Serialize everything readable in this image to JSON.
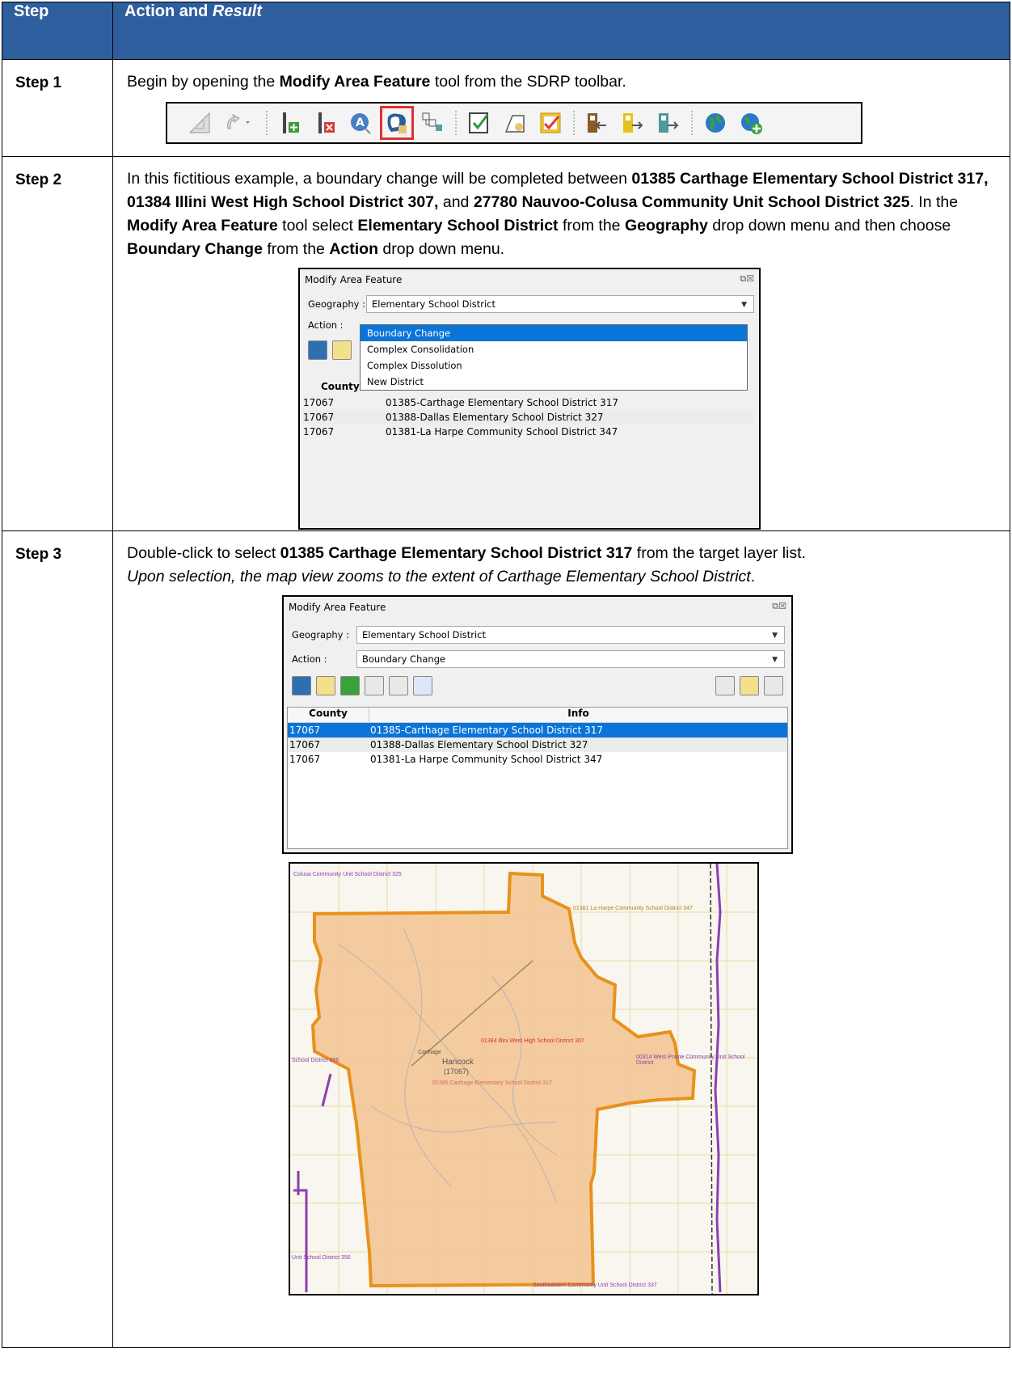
{
  "header": {
    "col1": "Step",
    "col2_prefix": "Action and ",
    "col2_italic": "Result"
  },
  "step1": {
    "label": "Step 1",
    "text_a": "Begin by opening the ",
    "bold_a": "Modify Area Feature",
    "text_b": " tool from the SDRP toolbar.",
    "toolbar_icons": [
      "ruler-icon",
      "pointer-dropdown-icon",
      "add-line-icon",
      "remove-line-icon",
      "label-tool-icon",
      "modify-area-feature-icon",
      "split-tool-icon",
      "validate-icon",
      "edit-polygon-icon",
      "save-polygon-icon",
      "import-icon",
      "export-icon",
      "transfer-icon",
      "globe-icon",
      "add-globe-icon"
    ]
  },
  "step2": {
    "label": "Step 2",
    "t1": "In this fictitious example, a boundary change will be completed between ",
    "b1": "01385 Carthage Elementary School District 317, 01384 Illini West High School District 307,",
    "t2": " and ",
    "b2": "27780 Nauvoo-Colusa Community Unit School District 325",
    "t3": ". In the ",
    "b3": "Modify Area Feature",
    "t4": " tool select ",
    "b4": "Elementary School District",
    "t5": " from the ",
    "b5": "Geography",
    "t6": " drop down menu and then choose ",
    "b6": "Boundary Change",
    "t7": " from the ",
    "b7": "Action",
    "t8": " drop down menu.",
    "dialog": {
      "title": "Modify Area Feature",
      "geography_label": "Geography :",
      "geography_value": "Elementary School District",
      "action_label": "Action :",
      "options": [
        "Boundary Change",
        "Complex Consolidation",
        "Complex Dissolution",
        "New District"
      ],
      "col_county": "County",
      "rows": [
        {
          "county": "17067",
          "info": "01385-Carthage Elementary School District 317"
        },
        {
          "county": "17067",
          "info": "01388-Dallas Elementary School District 327"
        },
        {
          "county": "17067",
          "info": "01381-La Harpe Community School District 347"
        }
      ]
    }
  },
  "step3": {
    "label": "Step 3",
    "t1": "Double-click to select ",
    "b1": "01385 Carthage Elementary School District 317",
    "t2": " from the target layer list.",
    "i1": "Upon selection, the map view zooms to the extent of Carthage Elementary School District",
    "i2": ".",
    "dialog": {
      "title": "Modify Area Feature",
      "geography_label": "Geography :",
      "geography_value": "Elementary School District",
      "action_label": "Action :",
      "action_value": "Boundary Change",
      "col_county": "County",
      "col_info": "Info",
      "rows": [
        {
          "county": "17067",
          "info": "01385-Carthage Elementary School District 317"
        },
        {
          "county": "17067",
          "info": "01388-Dallas Elementary School District 327"
        },
        {
          "county": "17067",
          "info": "01381-La Harpe Community School District 347"
        }
      ]
    },
    "map": {
      "labels": [
        "Colusa Community Unit School District 325",
        "01381 La Harpe Community School District 347",
        "01384 Illini West High School District 307",
        "Hancock",
        "(17067)",
        "01385 Carthage Elementary School District 317",
        "00314 West Prairie Community Unit School District",
        "School District 356",
        "Unit School District 356",
        "Carthage",
        "Southeastern Community Unit School District 337"
      ],
      "colors": {
        "district_fill": "#f3c38f",
        "district_border": "#e8911c",
        "purple_boundary": "#8b3fb0"
      }
    }
  }
}
